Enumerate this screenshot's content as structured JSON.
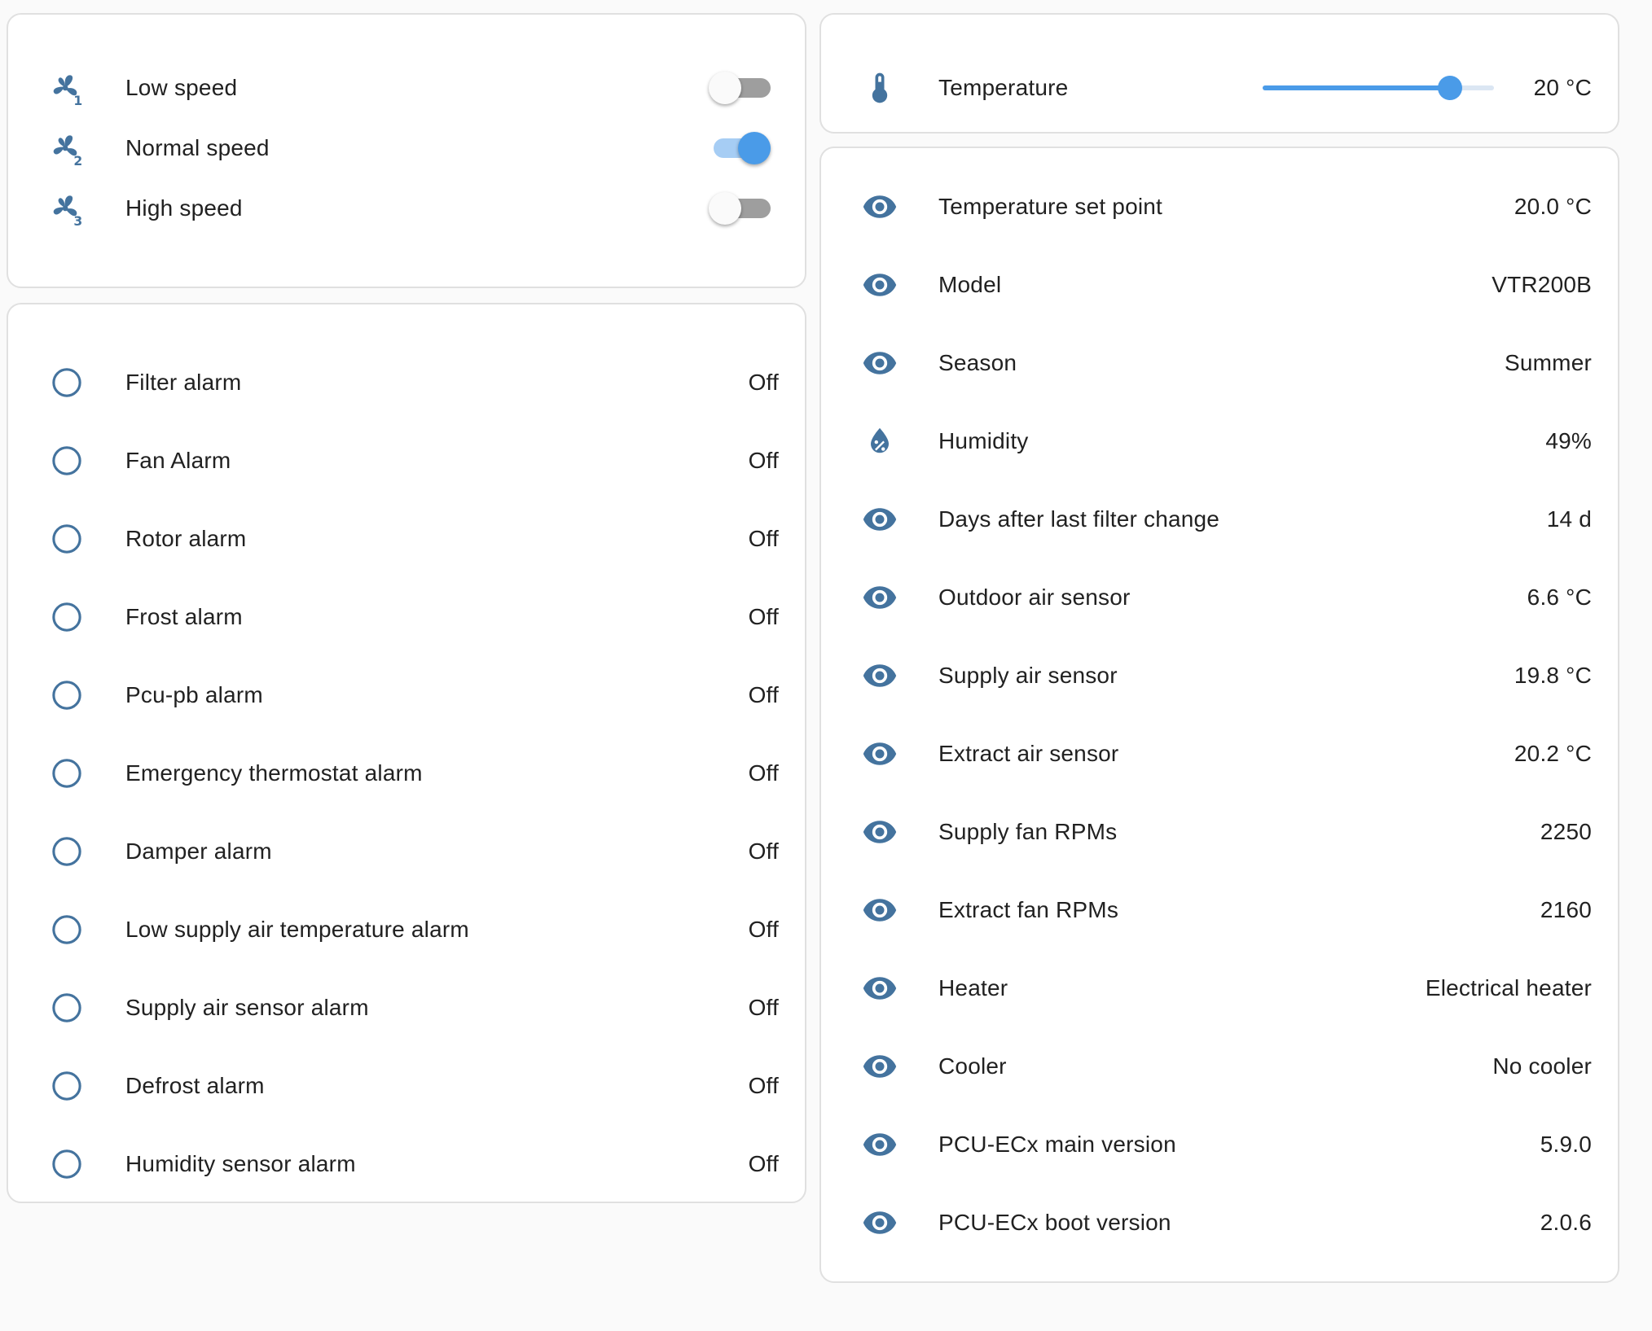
{
  "colors": {
    "icon": "#44739e",
    "accent": "#4a9be8",
    "toggle_off": "#9e9e9e"
  },
  "fans": [
    {
      "label": "Low speed",
      "icon": "fan-speed-1-icon",
      "on": false
    },
    {
      "label": "Normal speed",
      "icon": "fan-speed-2-icon",
      "on": true
    },
    {
      "label": "High speed",
      "icon": "fan-speed-3-icon",
      "on": false
    }
  ],
  "temperature": {
    "label": "Temperature",
    "value": "20 °C",
    "slider_fraction": 0.81,
    "icon": "thermometer-icon"
  },
  "alarms": [
    {
      "label": "Filter alarm",
      "value": "Off"
    },
    {
      "label": "Fan Alarm",
      "value": "Off"
    },
    {
      "label": "Rotor alarm",
      "value": "Off"
    },
    {
      "label": "Frost alarm",
      "value": "Off"
    },
    {
      "label": "Pcu-pb alarm",
      "value": "Off"
    },
    {
      "label": "Emergency thermostat alarm",
      "value": "Off"
    },
    {
      "label": "Damper alarm",
      "value": "Off"
    },
    {
      "label": "Low supply air temperature alarm",
      "value": "Off"
    },
    {
      "label": "Supply air sensor alarm",
      "value": "Off"
    },
    {
      "label": "Defrost alarm",
      "value": "Off"
    },
    {
      "label": "Humidity sensor alarm",
      "value": "Off"
    }
  ],
  "sensors": [
    {
      "label": "Temperature set point",
      "value": "20.0 °C",
      "icon": "eye-icon"
    },
    {
      "label": "Model",
      "value": "VTR200B",
      "icon": "eye-icon"
    },
    {
      "label": "Season",
      "value": "Summer",
      "icon": "eye-icon"
    },
    {
      "label": "Humidity",
      "value": "49%",
      "icon": "humidity-percent-icon"
    },
    {
      "label": "Days after last filter change",
      "value": "14 d",
      "icon": "eye-icon"
    },
    {
      "label": "Outdoor air sensor",
      "value": "6.6 °C",
      "icon": "eye-icon"
    },
    {
      "label": "Supply air sensor",
      "value": "19.8 °C",
      "icon": "eye-icon"
    },
    {
      "label": "Extract air sensor",
      "value": "20.2 °C",
      "icon": "eye-icon"
    },
    {
      "label": "Supply fan RPMs",
      "value": "2250",
      "icon": "eye-icon"
    },
    {
      "label": "Extract fan RPMs",
      "value": "2160",
      "icon": "eye-icon"
    },
    {
      "label": "Heater",
      "value": "Electrical heater",
      "icon": "eye-icon"
    },
    {
      "label": "Cooler",
      "value": "No cooler",
      "icon": "eye-icon"
    },
    {
      "label": "PCU-ECx main version",
      "value": "5.9.0",
      "icon": "eye-icon"
    },
    {
      "label": "PCU-ECx boot version",
      "value": "2.0.6",
      "icon": "eye-icon"
    }
  ]
}
